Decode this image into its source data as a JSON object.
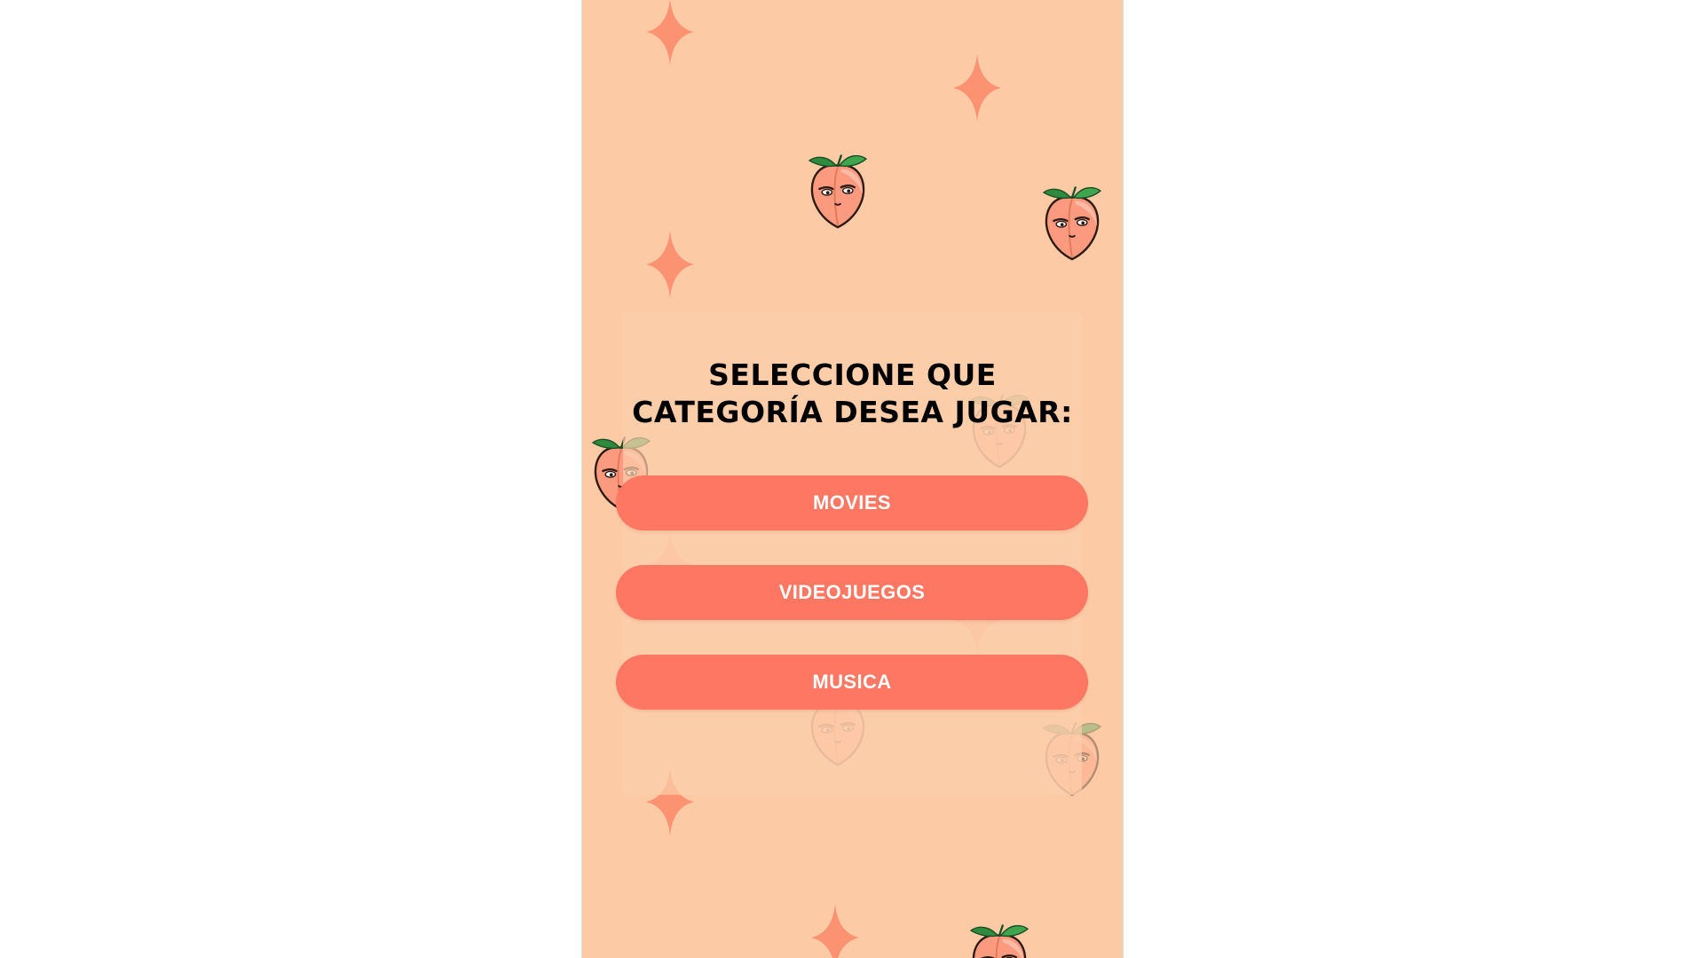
{
  "screen": {
    "heading": "SELECCIONE QUE CATEGORÍA DESEA JUGAR:"
  },
  "categories": [
    {
      "label": "MOVIES"
    },
    {
      "label": "VIDEOJUEGOS"
    },
    {
      "label": "MUSICA"
    }
  ],
  "colors": {
    "background": "#fccba6",
    "button": "#fe7762",
    "button_text": "#ffffff",
    "sparkle": "#fb9373",
    "peach": "#fb9a7e",
    "leaf": "#2e8b3e"
  },
  "decorations": {
    "sparkle_icon": "four-point-star-icon",
    "mascot_icon": "peach-face-icon"
  }
}
